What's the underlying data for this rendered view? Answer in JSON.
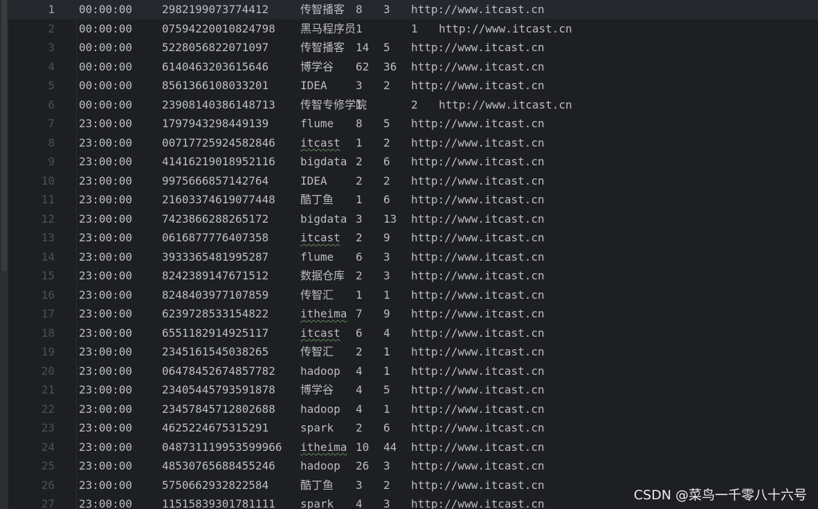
{
  "editor": {
    "current_line": 1,
    "lines": [
      {
        "n": "1",
        "time": "00:00:00",
        "id": "2982199073774412",
        "kw": "传智播客",
        "a": "8",
        "b": "3",
        "url": "http://www.itcast.cn",
        "shift": false,
        "typo": false
      },
      {
        "n": "2",
        "time": "00:00:00",
        "id": "07594220010824798",
        "kw": "黑马程序员",
        "a": "1",
        "b": "1",
        "url": "http://www.itcast.cn",
        "shift": true,
        "typo": false
      },
      {
        "n": "3",
        "time": "00:00:00",
        "id": "5228056822071097",
        "kw": "传智播客",
        "a": "14",
        "b": "5",
        "url": "http://www.itcast.cn",
        "shift": false,
        "typo": false
      },
      {
        "n": "4",
        "time": "00:00:00",
        "id": "6140463203615646",
        "kw": "博学谷",
        "a": "62",
        "b": "36",
        "url": "http://www.itcast.cn",
        "shift": false,
        "typo": false
      },
      {
        "n": "5",
        "time": "00:00:00",
        "id": "8561366108033201",
        "kw": "IDEA",
        "a": "3",
        "b": "2",
        "url": "http://www.itcast.cn",
        "shift": false,
        "typo": false
      },
      {
        "n": "6",
        "time": "00:00:00",
        "id": "23908140386148713",
        "kw": "传智专修学院",
        "a": "1",
        "b": "2",
        "url": "http://www.itcast.cn",
        "shift": true,
        "typo": false
      },
      {
        "n": "7",
        "time": "23:00:00",
        "id": "1797943298449139",
        "kw": "flume",
        "a": "8",
        "b": "5",
        "url": "http://www.itcast.cn",
        "shift": false,
        "typo": false
      },
      {
        "n": "8",
        "time": "23:00:00",
        "id": "00717725924582846",
        "kw": "itcast",
        "a": "1",
        "b": "2",
        "url": "http://www.itcast.cn",
        "shift": false,
        "typo": true
      },
      {
        "n": "9",
        "time": "23:00:00",
        "id": "41416219018952116",
        "kw": "bigdata",
        "a": "2",
        "b": "6",
        "url": "http://www.itcast.cn",
        "shift": false,
        "typo": false
      },
      {
        "n": "10",
        "time": "23:00:00",
        "id": "9975666857142764",
        "kw": "IDEA",
        "a": "2",
        "b": "2",
        "url": "http://www.itcast.cn",
        "shift": false,
        "typo": false
      },
      {
        "n": "11",
        "time": "23:00:00",
        "id": "21603374619077448",
        "kw": "酷丁鱼",
        "a": "1",
        "b": "6",
        "url": "http://www.itcast.cn",
        "shift": false,
        "typo": false
      },
      {
        "n": "12",
        "time": "23:00:00",
        "id": "7423866288265172",
        "kw": "bigdata",
        "a": "3",
        "b": "13",
        "url": "http://www.itcast.cn",
        "shift": false,
        "typo": false
      },
      {
        "n": "13",
        "time": "23:00:00",
        "id": "0616877776407358",
        "kw": "itcast",
        "a": "2",
        "b": "9",
        "url": "http://www.itcast.cn",
        "shift": false,
        "typo": true
      },
      {
        "n": "14",
        "time": "23:00:00",
        "id": "3933365481995287",
        "kw": "flume",
        "a": "6",
        "b": "3",
        "url": "http://www.itcast.cn",
        "shift": false,
        "typo": false
      },
      {
        "n": "15",
        "time": "23:00:00",
        "id": "8242389147671512",
        "kw": "数据仓库",
        "a": "2",
        "b": "3",
        "url": "http://www.itcast.cn",
        "shift": false,
        "typo": false
      },
      {
        "n": "16",
        "time": "23:00:00",
        "id": "8248403977107859",
        "kw": "传智汇",
        "a": "1",
        "b": "1",
        "url": "http://www.itcast.cn",
        "shift": false,
        "typo": false
      },
      {
        "n": "17",
        "time": "23:00:00",
        "id": "6239728533154822",
        "kw": "itheima",
        "a": "7",
        "b": "9",
        "url": "http://www.itcast.cn",
        "shift": false,
        "typo": true
      },
      {
        "n": "18",
        "time": "23:00:00",
        "id": "6551182914925117",
        "kw": "itcast",
        "a": "6",
        "b": "4",
        "url": "http://www.itcast.cn",
        "shift": false,
        "typo": true
      },
      {
        "n": "19",
        "time": "23:00:00",
        "id": "2345161545038265",
        "kw": "传智汇",
        "a": "2",
        "b": "1",
        "url": "http://www.itcast.cn",
        "shift": false,
        "typo": false
      },
      {
        "n": "20",
        "time": "23:00:00",
        "id": "06478452674857782",
        "kw": "hadoop",
        "a": "4",
        "b": "1",
        "url": "http://www.itcast.cn",
        "shift": false,
        "typo": false
      },
      {
        "n": "21",
        "time": "23:00:00",
        "id": "23405445793591878",
        "kw": "博学谷",
        "a": "4",
        "b": "5",
        "url": "http://www.itcast.cn",
        "shift": false,
        "typo": false
      },
      {
        "n": "22",
        "time": "23:00:00",
        "id": "23457845712802688",
        "kw": "hadoop",
        "a": "4",
        "b": "1",
        "url": "http://www.itcast.cn",
        "shift": false,
        "typo": false
      },
      {
        "n": "23",
        "time": "23:00:00",
        "id": "4625224675315291",
        "kw": "spark",
        "a": "2",
        "b": "6",
        "url": "http://www.itcast.cn",
        "shift": false,
        "typo": false
      },
      {
        "n": "24",
        "time": "23:00:00",
        "id": "048731119953599966",
        "kw": "itheima",
        "a": "10",
        "b": "44",
        "url": "http://www.itcast.cn",
        "shift": false,
        "typo": true
      },
      {
        "n": "25",
        "time": "23:00:00",
        "id": "48530765688455246",
        "kw": "hadoop",
        "a": "26",
        "b": "3",
        "url": "http://www.itcast.cn",
        "shift": false,
        "typo": false
      },
      {
        "n": "26",
        "time": "23:00:00",
        "id": "5750662932822584",
        "kw": "酷丁鱼",
        "a": "3",
        "b": "2",
        "url": "http://www.itcast.cn",
        "shift": false,
        "typo": false
      },
      {
        "n": "27",
        "time": "23:00:00",
        "id": "11515839301781111",
        "kw": "spark",
        "a": "4",
        "b": "3",
        "url": "http://www.itcast.cn",
        "shift": false,
        "typo": false
      }
    ]
  },
  "watermark": "CSDN @菜鸟一千零八十六号",
  "colors": {
    "background": "#1e1f22",
    "text": "#bcbec4",
    "line_number": "#4b5059",
    "current_line": "#26282e",
    "typo_underline": "#5f8a5a"
  }
}
